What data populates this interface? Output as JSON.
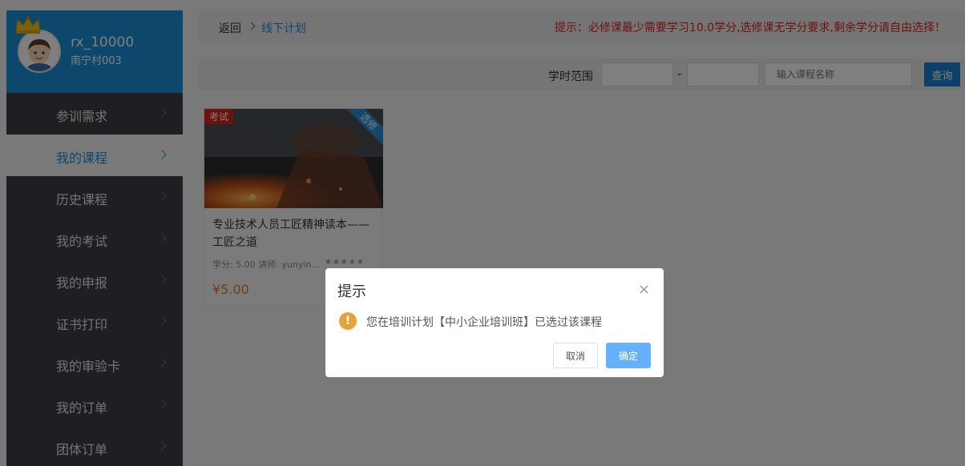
{
  "user": {
    "name": "rx_10000",
    "org": "南宁村003"
  },
  "menu": [
    {
      "label": "参训需求",
      "active": false
    },
    {
      "label": "我的课程",
      "active": true
    },
    {
      "label": "历史课程",
      "active": false
    },
    {
      "label": "我的考试",
      "active": false
    },
    {
      "label": "我的申报",
      "active": false
    },
    {
      "label": "证书打印",
      "active": false
    },
    {
      "label": "我的审验卡",
      "active": false
    },
    {
      "label": "我的订单",
      "active": false
    },
    {
      "label": "团体订单",
      "active": false
    }
  ],
  "breadcrumb": {
    "back": "返回",
    "current": "线下计划"
  },
  "tip": "提示：必修课最少需要学习10.0学分,选修课无学分要求,剩余学分请自由选择！",
  "filter": {
    "label": "学时范围",
    "dash": "-",
    "placeholder": "输入课程名称",
    "query": "查询"
  },
  "course": {
    "exam_tag": "考试",
    "type_tag": "选修",
    "title": "专业技术人员工匠精神读本——工匠之道",
    "meta": "学分: 5.00 讲师: yunyin...",
    "stars": "★★★★★",
    "price": "¥5.00"
  },
  "dialog": {
    "title": "提示",
    "close": "×",
    "warn_icon": "!",
    "message": "您在培训计划【中小企业培训班】已选过该课程",
    "cancel": "取消",
    "confirm": "确定"
  },
  "colors": {
    "brand": "#1a8fd6",
    "sidebar": "#3a3f44",
    "tip_red": "#d9261c",
    "price": "#e87722",
    "confirm": "#66b1ff"
  }
}
